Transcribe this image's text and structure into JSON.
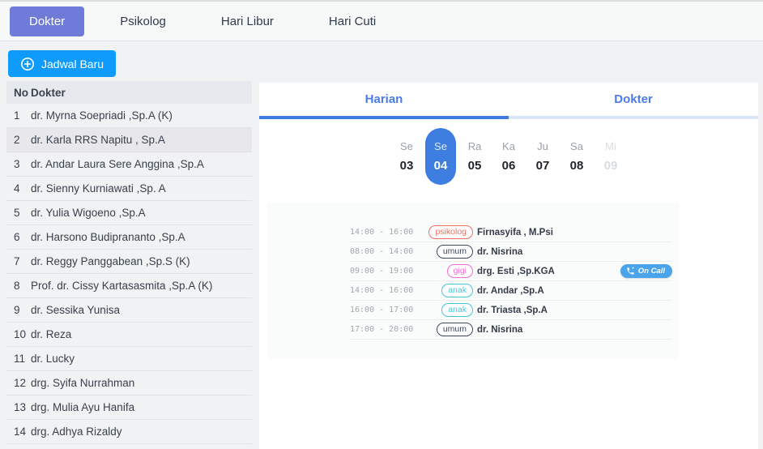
{
  "top_tabs": [
    {
      "label": "Dokter",
      "active": true
    },
    {
      "label": "Psikolog",
      "active": false
    },
    {
      "label": "Hari Libur",
      "active": false
    },
    {
      "label": "Hari Cuti",
      "active": false
    }
  ],
  "left": {
    "new_schedule_button": "Jadwal Baru",
    "table": {
      "header_no": "No",
      "header_doctor": "Dokter",
      "rows": [
        {
          "no": "1",
          "name": "dr. Myrna Soepriadi ,Sp.A (K)",
          "highlighted": false
        },
        {
          "no": "2",
          "name": "dr. Karla RRS Napitu , Sp.A",
          "highlighted": true
        },
        {
          "no": "3",
          "name": "dr. Andar Laura Sere Anggina ,Sp.A",
          "highlighted": false
        },
        {
          "no": "4",
          "name": "dr. Sienny Kurniawati ,Sp. A",
          "highlighted": false
        },
        {
          "no": "5",
          "name": "dr. Yulia Wigoeno ,Sp.A",
          "highlighted": false
        },
        {
          "no": "6",
          "name": "dr. Harsono Budiprananto ,Sp.A",
          "highlighted": false
        },
        {
          "no": "7",
          "name": "dr. Reggy Panggabean ,Sp.S (K)",
          "highlighted": false
        },
        {
          "no": "8",
          "name": "Prof. dr. Cissy Kartasasmita ,Sp.A (K)",
          "highlighted": false
        },
        {
          "no": "9",
          "name": "dr. Sessika Yunisa",
          "highlighted": false
        },
        {
          "no": "10",
          "name": "dr. Reza",
          "highlighted": false
        },
        {
          "no": "11",
          "name": "dr. Lucky",
          "highlighted": false
        },
        {
          "no": "12",
          "name": "drg. Syifa Nurrahman",
          "highlighted": false
        },
        {
          "no": "13",
          "name": "drg. Mulia Ayu Hanifa",
          "highlighted": false
        },
        {
          "no": "14",
          "name": "drg. Adhya Rizaldy",
          "highlighted": false
        }
      ]
    }
  },
  "right": {
    "tabs": [
      {
        "label": "Harian",
        "active": true
      },
      {
        "label": "Dokter",
        "active": false
      }
    ],
    "week": [
      {
        "dow": "Se",
        "date": "03",
        "selected": false,
        "disabled": false
      },
      {
        "dow": "Se",
        "date": "04",
        "selected": true,
        "disabled": false
      },
      {
        "dow": "Ra",
        "date": "05",
        "selected": false,
        "disabled": false
      },
      {
        "dow": "Ka",
        "date": "06",
        "selected": false,
        "disabled": false
      },
      {
        "dow": "Ju",
        "date": "07",
        "selected": false,
        "disabled": false
      },
      {
        "dow": "Sa",
        "date": "08",
        "selected": false,
        "disabled": false
      },
      {
        "dow": "Mi",
        "date": "09",
        "selected": false,
        "disabled": true
      }
    ],
    "schedule": [
      {
        "time": "14:00 - 16:00",
        "category": "psikolog",
        "color": "#ed6f61",
        "name": "Firnasyifa , M.Psi",
        "on_call": false,
        "on_call_label": ""
      },
      {
        "time": "08:00 - 14:00",
        "category": "umum",
        "color": "#3d4763",
        "name": "dr. Nisrina",
        "on_call": false,
        "on_call_label": ""
      },
      {
        "time": "09:00 - 19:00",
        "category": "gigi",
        "color": "#ee6bd6",
        "name": "drg. Esti ,Sp.KGA",
        "on_call": true,
        "on_call_label": "On Call"
      },
      {
        "time": "14:00 - 16:00",
        "category": "anak",
        "color": "#41c8da",
        "name": "dr. Andar ,Sp.A",
        "on_call": false,
        "on_call_label": ""
      },
      {
        "time": "16:00 - 17:00",
        "category": "anak",
        "color": "#41c8da",
        "name": "dr. Triasta ,Sp.A",
        "on_call": false,
        "on_call_label": ""
      },
      {
        "time": "17:00 - 20:00",
        "category": "umum",
        "color": "#3d4763",
        "name": "dr. Nisrina",
        "on_call": false,
        "on_call_label": ""
      }
    ]
  },
  "colors": {
    "accent_blue": "#3d7ee0",
    "top_tab_active_bg": "#6f7bd9",
    "new_button_bg": "#0f9bfb",
    "oncall_bg": "#4aa4eb",
    "highlight_row": "#e8e8ea"
  }
}
